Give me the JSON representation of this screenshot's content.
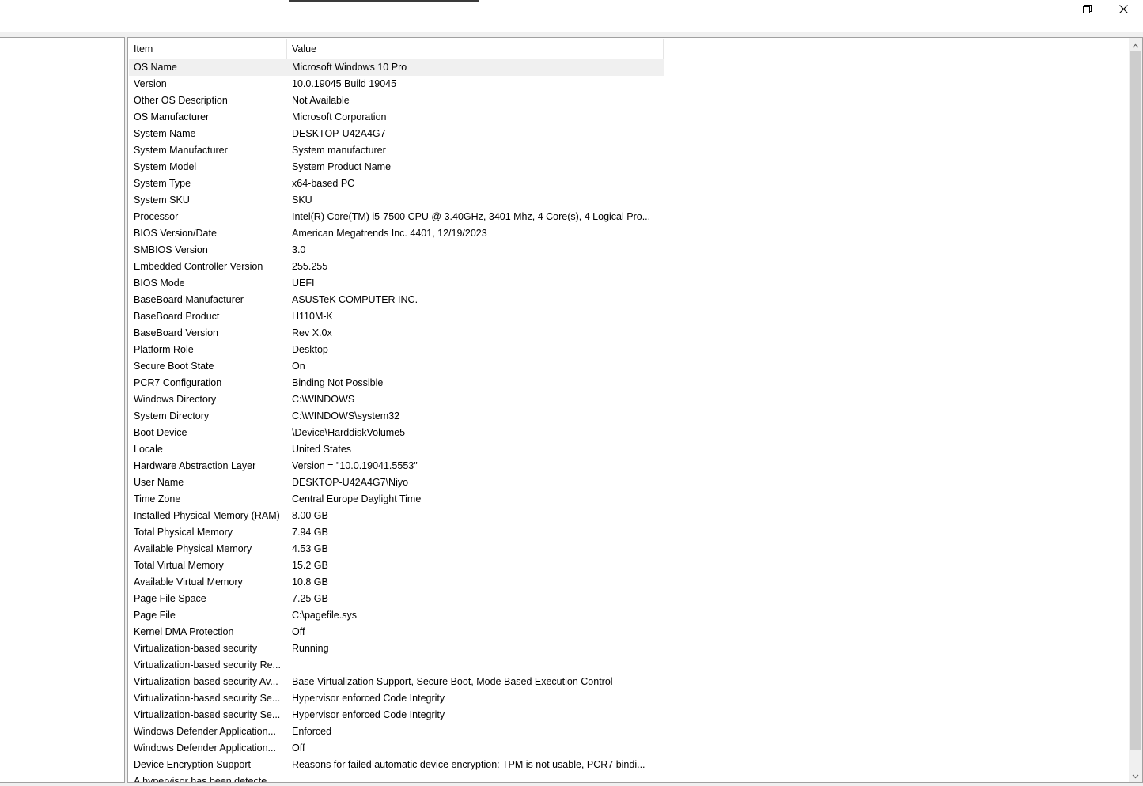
{
  "window": {
    "minimize_icon": "minimize-icon",
    "restore_icon": "restore-icon",
    "close_icon": "close-icon"
  },
  "table": {
    "columns": {
      "item": "Item",
      "value": "Value"
    },
    "rows": [
      {
        "item": "OS Name",
        "value": "Microsoft Windows 10 Pro"
      },
      {
        "item": "Version",
        "value": "10.0.19045 Build 19045"
      },
      {
        "item": "Other OS Description",
        "value": "Not Available"
      },
      {
        "item": "OS Manufacturer",
        "value": "Microsoft Corporation"
      },
      {
        "item": "System Name",
        "value": "DESKTOP-U42A4G7"
      },
      {
        "item": "System Manufacturer",
        "value": "System manufacturer"
      },
      {
        "item": "System Model",
        "value": "System Product Name"
      },
      {
        "item": "System Type",
        "value": "x64-based PC"
      },
      {
        "item": "System SKU",
        "value": "SKU"
      },
      {
        "item": "Processor",
        "value": "Intel(R) Core(TM) i5-7500 CPU @ 3.40GHz, 3401 Mhz, 4 Core(s), 4 Logical Pro..."
      },
      {
        "item": "BIOS Version/Date",
        "value": "American Megatrends Inc. 4401, 12/19/2023"
      },
      {
        "item": "SMBIOS Version",
        "value": "3.0"
      },
      {
        "item": "Embedded Controller Version",
        "value": "255.255"
      },
      {
        "item": "BIOS Mode",
        "value": "UEFI"
      },
      {
        "item": "BaseBoard Manufacturer",
        "value": "ASUSTeK COMPUTER INC."
      },
      {
        "item": "BaseBoard Product",
        "value": "H110M-K"
      },
      {
        "item": "BaseBoard Version",
        "value": "Rev X.0x"
      },
      {
        "item": "Platform Role",
        "value": "Desktop"
      },
      {
        "item": "Secure Boot State",
        "value": "On"
      },
      {
        "item": "PCR7 Configuration",
        "value": "Binding Not Possible"
      },
      {
        "item": "Windows Directory",
        "value": "C:\\WINDOWS"
      },
      {
        "item": "System Directory",
        "value": "C:\\WINDOWS\\system32"
      },
      {
        "item": "Boot Device",
        "value": "\\Device\\HarddiskVolume5"
      },
      {
        "item": "Locale",
        "value": "United States"
      },
      {
        "item": "Hardware Abstraction Layer",
        "value": "Version = \"10.0.19041.5553\""
      },
      {
        "item": "User Name",
        "value": "DESKTOP-U42A4G7\\Niyo"
      },
      {
        "item": "Time Zone",
        "value": "Central Europe Daylight Time"
      },
      {
        "item": "Installed Physical Memory (RAM)",
        "value": "8.00 GB"
      },
      {
        "item": "Total Physical Memory",
        "value": "7.94 GB"
      },
      {
        "item": "Available Physical Memory",
        "value": "4.53 GB"
      },
      {
        "item": "Total Virtual Memory",
        "value": "15.2 GB"
      },
      {
        "item": "Available Virtual Memory",
        "value": "10.8 GB"
      },
      {
        "item": "Page File Space",
        "value": "7.25 GB"
      },
      {
        "item": "Page File",
        "value": "C:\\pagefile.sys"
      },
      {
        "item": "Kernel DMA Protection",
        "value": "Off"
      },
      {
        "item": "Virtualization-based security",
        "value": "Running"
      },
      {
        "item": "Virtualization-based security Re...",
        "value": ""
      },
      {
        "item": "Virtualization-based security Av...",
        "value": "Base Virtualization Support, Secure Boot, Mode Based Execution Control"
      },
      {
        "item": "Virtualization-based security Se...",
        "value": "Hypervisor enforced Code Integrity"
      },
      {
        "item": "Virtualization-based security Se...",
        "value": "Hypervisor enforced Code Integrity"
      },
      {
        "item": "Windows Defender Application...",
        "value": "Enforced"
      },
      {
        "item": "Windows Defender Application...",
        "value": "Off"
      },
      {
        "item": "Device Encryption Support",
        "value": "Reasons for failed automatic device encryption: TPM is not usable, PCR7 bindi..."
      },
      {
        "item": "A hypervisor has been detecte...",
        "value": ""
      }
    ],
    "selected_row": 0
  },
  "scrollbar": {
    "up_icon": "chevron-up-icon",
    "down_icon": "chevron-down-icon"
  }
}
